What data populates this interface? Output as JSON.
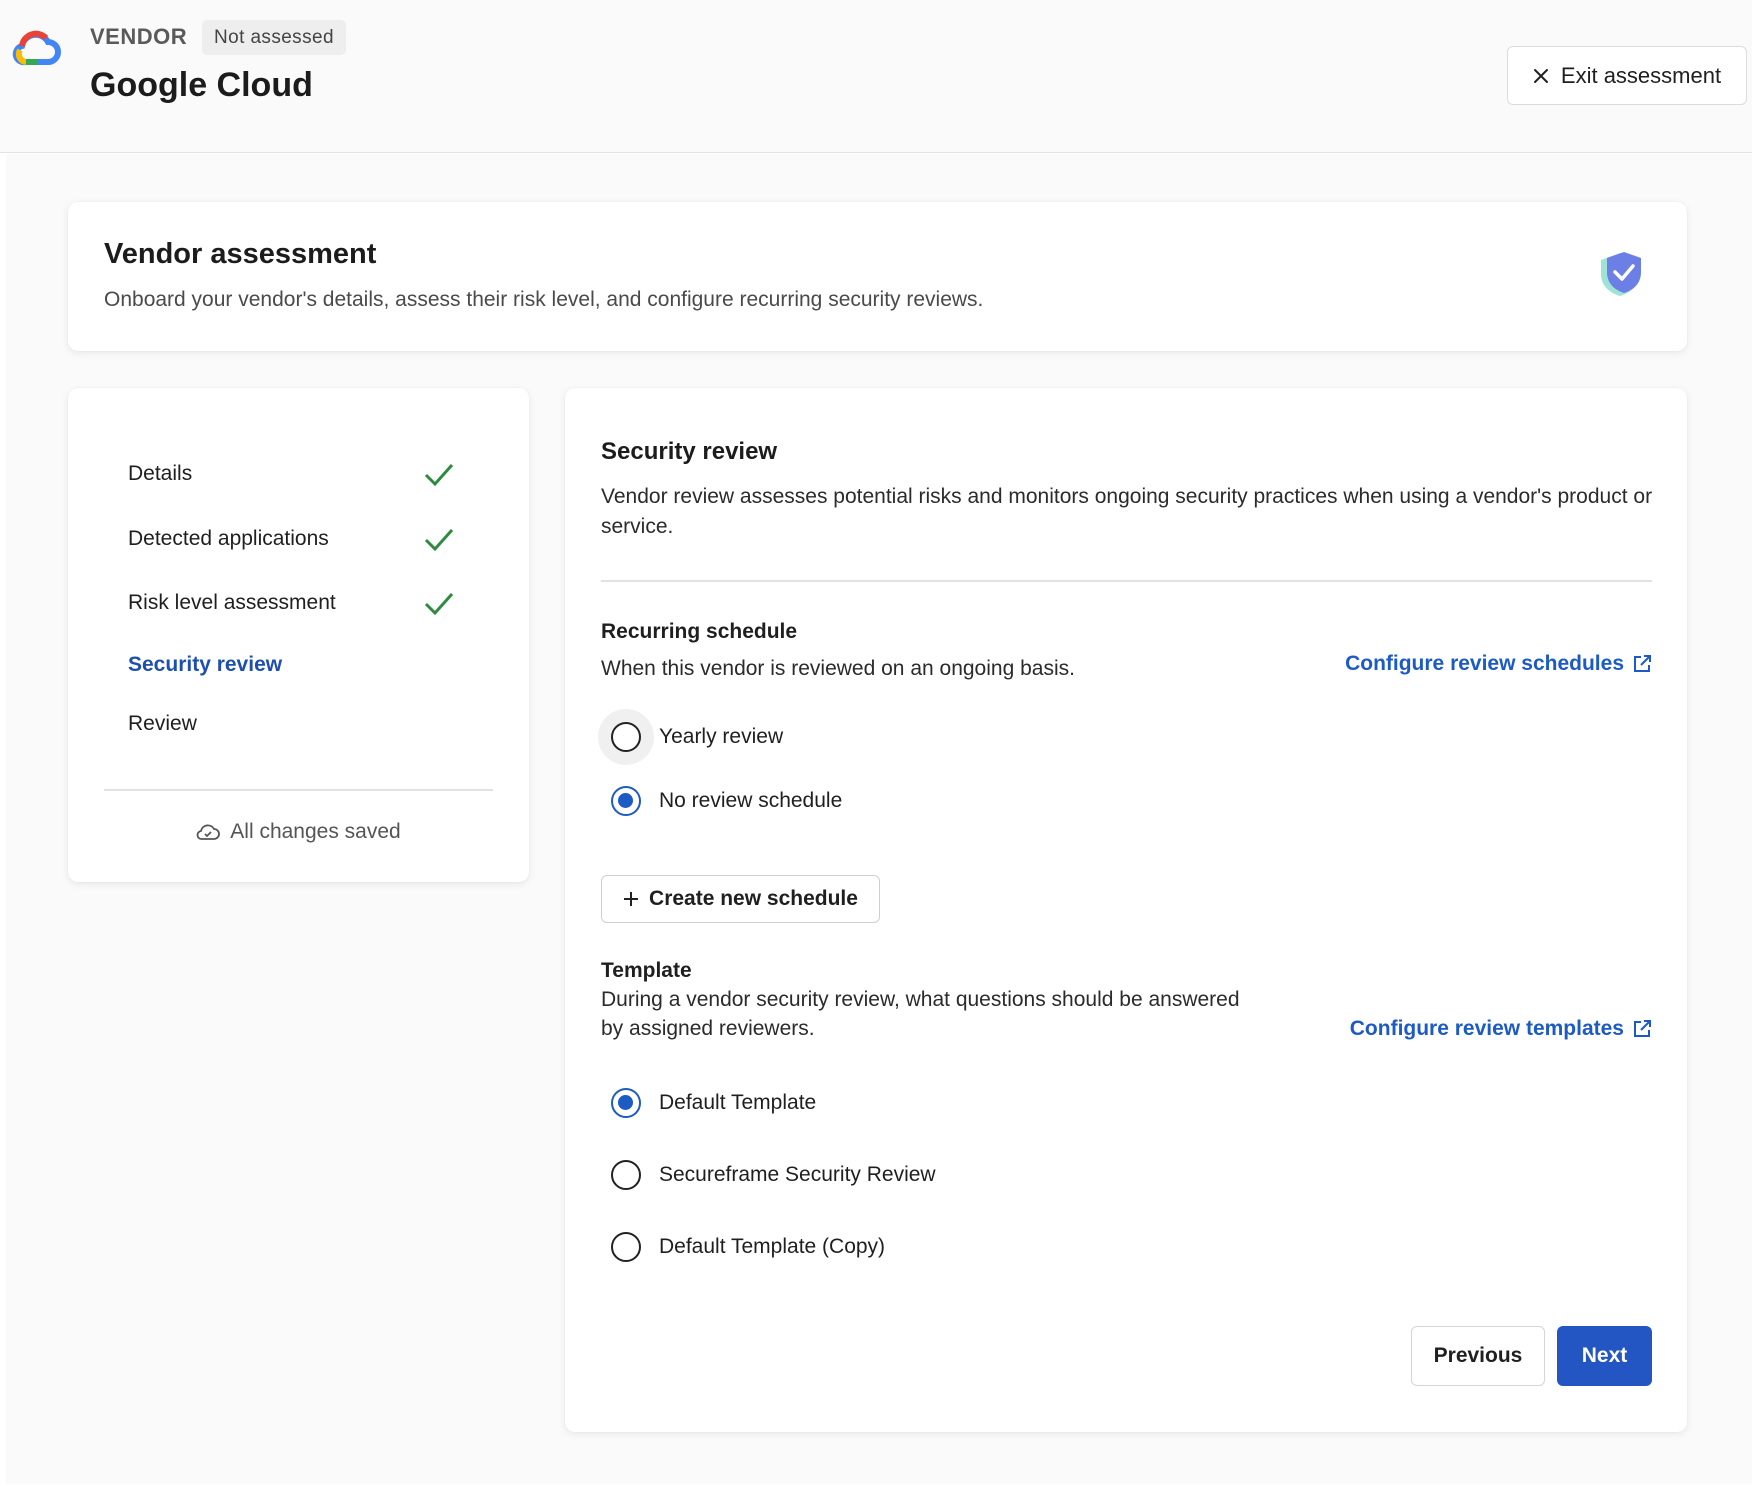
{
  "header": {
    "logo_icon": "google-cloud-logo",
    "vendor_label": "VENDOR",
    "status_badge": "Not assessed",
    "vendor_name": "Google Cloud",
    "exit_label": "Exit assessment",
    "exit_icon": "close-icon"
  },
  "intro": {
    "title": "Vendor assessment",
    "description": "Onboard your vendor's details, assess their risk level, and configure recurring security reviews.",
    "icon": "shield-check-icon"
  },
  "steps": {
    "items": [
      {
        "label": "Details",
        "completed": true
      },
      {
        "label": "Detected applications",
        "completed": true
      },
      {
        "label": "Risk level assessment",
        "completed": true
      },
      {
        "label": "Security review",
        "completed": false,
        "active": true
      },
      {
        "label": "Review",
        "completed": false
      }
    ],
    "saved_label": "All changes saved",
    "saved_icon": "cloud-check-icon"
  },
  "security_review": {
    "title": "Security review",
    "description": "Vendor review assesses potential risks and monitors ongoing security practices when using a vendor's product or service.",
    "schedule": {
      "title": "Recurring schedule",
      "description": "When this vendor is reviewed on an ongoing basis.",
      "link_label": "Configure review schedules",
      "options": [
        {
          "label": "Yearly review",
          "selected": false
        },
        {
          "label": "No review schedule",
          "selected": true
        }
      ],
      "create_label": "Create new schedule"
    },
    "template": {
      "title": "Template",
      "description": "During a vendor security review, what questions should be answered by assigned reviewers.",
      "link_label": "Configure review templates",
      "options": [
        {
          "label": "Default Template",
          "selected": true
        },
        {
          "label": "Secureframe Security Review",
          "selected": false
        },
        {
          "label": "Default Template (Copy)",
          "selected": false
        }
      ]
    },
    "previous_label": "Previous",
    "next_label": "Next"
  },
  "colors": {
    "accent": "#2356c2",
    "link": "#1d5bc4",
    "success": "#2e8b3e"
  }
}
